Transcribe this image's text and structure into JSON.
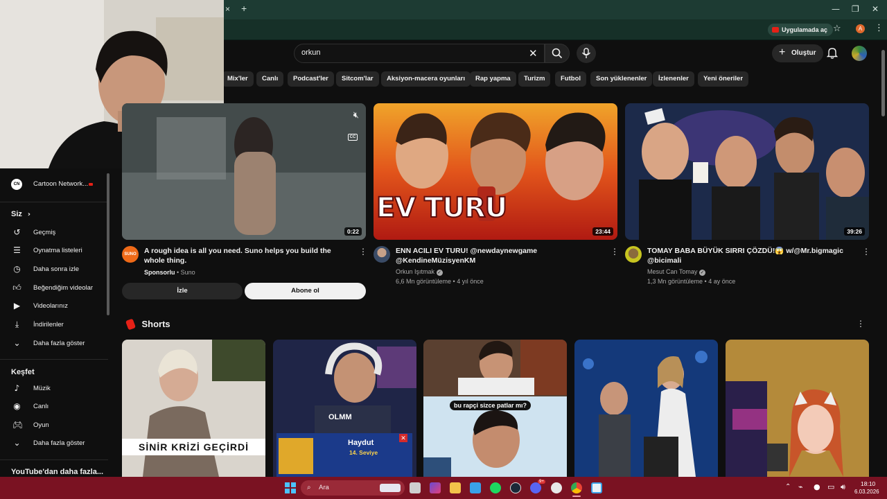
{
  "browser": {
    "tab_close": "×",
    "new_tab": "+",
    "open_in_app": "Uygulamada aç",
    "profile_initial": "A"
  },
  "header": {
    "search_value": "orkun",
    "create_label": "Oluştur"
  },
  "chips": [
    "Mix'ler",
    "Canlı",
    "Podcast'ler",
    "Sitcom'lar",
    "Aksiyon-macera oyunları",
    "Rap yapma",
    "Turizm",
    "Futbol",
    "Son yüklenenler",
    "İzlenenler",
    "Yeni öneriler"
  ],
  "sidebar": {
    "subscription_item": "Cartoon Network...",
    "you_header": "Siz",
    "you_items": [
      "Geçmiş",
      "Oynatma listeleri",
      "Daha sonra izle",
      "Beğendiğim videolar",
      "Videolarınız",
      "İndirilenler",
      "Daha fazla göster"
    ],
    "explore_header": "Keşfet",
    "explore_items": [
      "Müzik",
      "Canlı",
      "Oyun",
      "Daha fazla göster"
    ],
    "more_header": "YouTube'dan daha fazla..."
  },
  "ad": {
    "duration": "0:22",
    "title": "A rough idea is all you need. Suno helps you build the whole thing.",
    "sponsored": "Sponsorlu",
    "advertiser": "Suno",
    "watch_label": "İzle",
    "subscribe_label": "Abone ol",
    "avatar_text": "SUNO"
  },
  "videos": [
    {
      "thumb_text": "EV TURU",
      "duration": "23:44",
      "title": "ENN ACILI EV TURU! @newdaynewgame @KendineMüzisyenKM",
      "channel": "Orkun Işıtmak",
      "stats": "6,6 Mn görüntüleme • 4 yıl önce"
    },
    {
      "duration": "39:26",
      "title": "TOMAY BABA BÜYÜK SIRRI ÇÖZDÜ!😱 w/@Mr.bigmagic @bicimali",
      "channel": "Mesut Can Tomay",
      "stats": "1,3 Mn görüntüleme • 4 ay önce"
    }
  ],
  "shorts": {
    "header": "Shorts",
    "items": [
      {
        "caption": "SİNİR KRİZİ GEÇİRDİ"
      },
      {
        "caption": "OLMM",
        "card_title": "Haydut",
        "card_sub": "14. Seviye"
      },
      {
        "caption": "bu rapçi sizce patlar mı?"
      },
      {
        "caption": ""
      },
      {
        "caption": ""
      }
    ]
  },
  "taskbar": {
    "search_placeholder": "Ara",
    "time": "18:10",
    "date": "6.03.2026",
    "notif_badge": "9+"
  }
}
